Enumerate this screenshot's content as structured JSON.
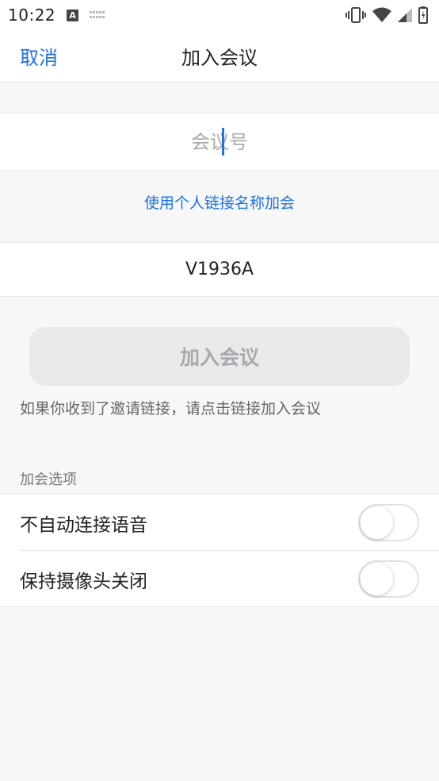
{
  "status_bar": {
    "time": "10:22",
    "icons": [
      "a-notification-icon",
      "keyboard-icon",
      "vibrate-icon",
      "wifi-icon",
      "signal-icon",
      "battery-icon"
    ]
  },
  "nav": {
    "cancel_label": "取消",
    "title": "加入会议"
  },
  "meeting_id": {
    "placeholder": "会议号",
    "value": ""
  },
  "personal_link_label": "使用个人链接名称加会",
  "display_name": {
    "value": "V1936A"
  },
  "join_button": {
    "label": "加入会议",
    "enabled": false
  },
  "hint_text": "如果你收到了邀请链接，请点击链接加入会议",
  "options_section": {
    "title": "加会选项",
    "items": [
      {
        "label": "不自动连接语音",
        "on": false
      },
      {
        "label": "保持摄像头关闭",
        "on": false
      }
    ]
  },
  "colors": {
    "accent": "#1e73e8",
    "background": "#f7f7f7",
    "disabled_button": "#e9e9ec"
  }
}
